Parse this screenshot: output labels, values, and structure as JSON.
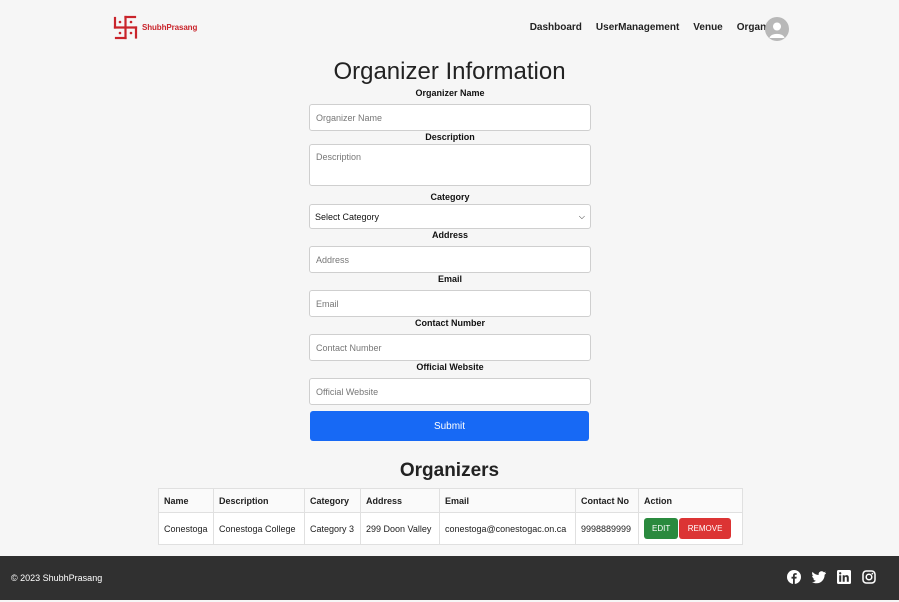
{
  "brand": {
    "name": "ShubhPrasang",
    "color": "#c9242b"
  },
  "nav": {
    "items": [
      {
        "label": "Dashboard"
      },
      {
        "label": "UserManagement"
      },
      {
        "label": "Venue"
      },
      {
        "label": "Organizers"
      }
    ],
    "avatar_icon": "user-avatar-icon"
  },
  "form": {
    "title": "Organizer Information",
    "fields": {
      "name": {
        "label": "Organizer Name",
        "placeholder": "Organizer Name"
      },
      "description": {
        "label": "Description",
        "placeholder": "Description"
      },
      "category": {
        "label": "Category",
        "selected": "Select Category"
      },
      "address": {
        "label": "Address",
        "placeholder": "Address"
      },
      "email": {
        "label": "Email",
        "placeholder": "Email"
      },
      "contact": {
        "label": "Contact Number",
        "placeholder": "Contact Number"
      },
      "website": {
        "label": "Official Website",
        "placeholder": "Official Website"
      }
    },
    "submit_label": "Submit",
    "submit_color": "#1769f5"
  },
  "table": {
    "title": "Organizers",
    "headers": [
      "Name",
      "Description",
      "Category",
      "Address",
      "Email",
      "Contact No",
      "Action"
    ],
    "rows": [
      {
        "name": "Conestoga",
        "description": "Conestoga College",
        "category": "Category 3",
        "address": "299 Doon Valley",
        "email": "conestoga@conestogac.on.ca",
        "contact": "9998889999",
        "edit_label": "EDIT",
        "remove_label": "REMOVE"
      }
    ],
    "edit_color": "#2a8a3e",
    "remove_color": "#dc3434"
  },
  "footer": {
    "copyright": "© 2023 ShubhPrasang",
    "social_icons": [
      "facebook-icon",
      "twitter-icon",
      "linkedin-icon",
      "instagram-icon"
    ]
  }
}
